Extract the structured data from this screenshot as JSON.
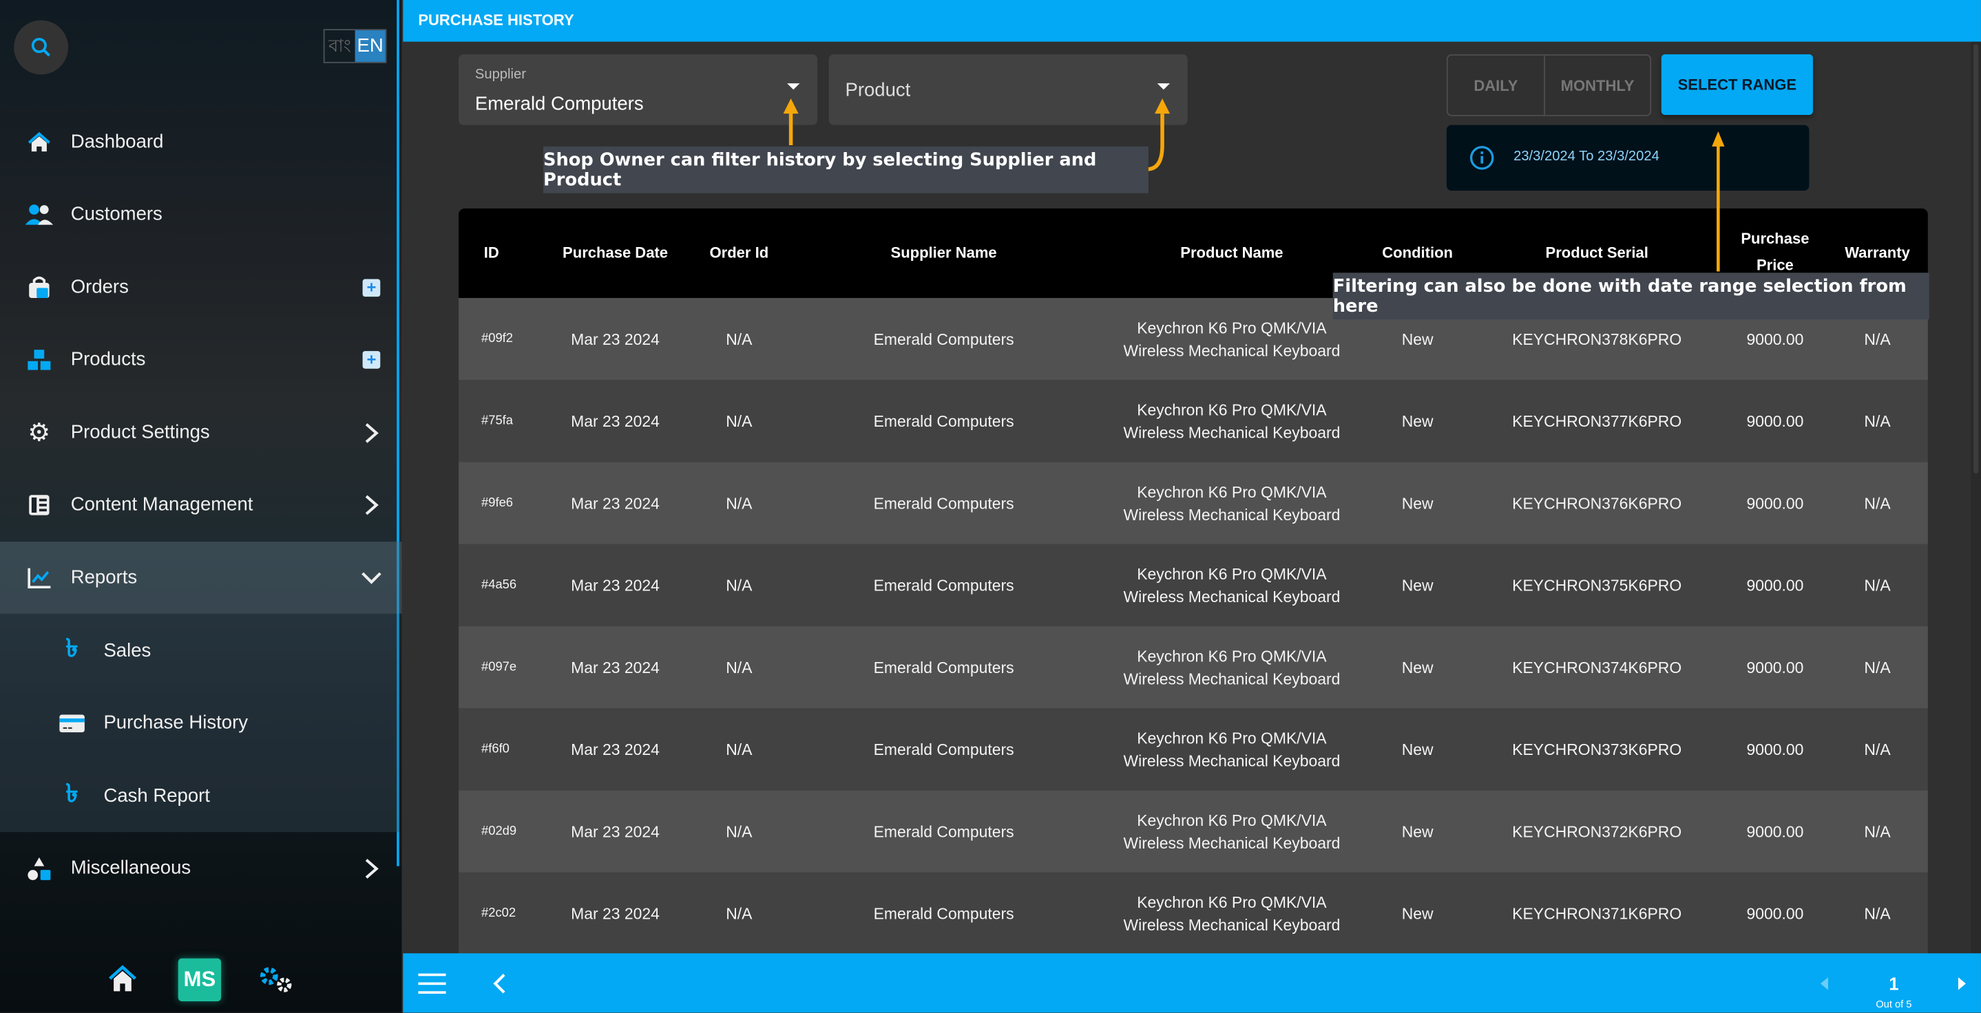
{
  "sidebar": {
    "lang": {
      "bn": "বাং",
      "en": "EN"
    },
    "items": [
      {
        "label": "Dashboard",
        "icon": "home-icon"
      },
      {
        "label": "Customers",
        "icon": "customers-icon"
      },
      {
        "label": "Orders",
        "icon": "orders-bag-icon"
      },
      {
        "label": "Products",
        "icon": "products-boxes-icon"
      },
      {
        "label": "Product Settings",
        "icon": "gear-icon"
      },
      {
        "label": "Content Management",
        "icon": "content-icon"
      },
      {
        "label": "Reports",
        "icon": "chart-line-icon"
      },
      {
        "label": "Miscellaneous",
        "icon": "shapes-icon"
      }
    ],
    "sub_items": [
      {
        "label": "Sales",
        "icon": "taka-icon"
      },
      {
        "label": "Purchase History",
        "icon": "credit-card-icon"
      },
      {
        "label": "Cash Report",
        "icon": "taka-icon"
      }
    ],
    "footer": {
      "logo": "MS"
    }
  },
  "header": {
    "title": "PURCHASE HISTORY"
  },
  "filters": {
    "supplier_label": "Supplier",
    "supplier_value": "Emerald Computers",
    "product_placeholder": "Product",
    "daily": "DAILY",
    "monthly": "MONTHLY",
    "select_range": "SELECT RANGE",
    "range_text": "23/3/2024 To 23/3/2024"
  },
  "annotations": {
    "filter_note": "Shop Owner can filter history by selecting Supplier and Product",
    "range_note": "Filtering can also be done with date range selection from here",
    "arrow_color": "#f5a70a"
  },
  "table": {
    "columns": [
      "ID",
      "Purchase Date",
      "Order Id",
      "Supplier Name",
      "Product Name",
      "Condition",
      "Product Serial",
      "Purchase Price",
      "Warranty"
    ],
    "rows": [
      [
        "#09f2",
        "Mar 23 2024",
        "N/A",
        "Emerald Computers",
        "Keychron K6 Pro QMK/VIA\nWireless Mechanical Keyboard",
        "New",
        "KEYCHRON378K6PRO",
        "9000.00",
        "N/A"
      ],
      [
        "#75fa",
        "Mar 23 2024",
        "N/A",
        "Emerald Computers",
        "Keychron K6 Pro QMK/VIA\nWireless Mechanical Keyboard",
        "New",
        "KEYCHRON377K6PRO",
        "9000.00",
        "N/A"
      ],
      [
        "#9fe6",
        "Mar 23 2024",
        "N/A",
        "Emerald Computers",
        "Keychron K6 Pro QMK/VIA\nWireless Mechanical Keyboard",
        "New",
        "KEYCHRON376K6PRO",
        "9000.00",
        "N/A"
      ],
      [
        "#4a56",
        "Mar 23 2024",
        "N/A",
        "Emerald Computers",
        "Keychron K6 Pro QMK/VIA\nWireless Mechanical Keyboard",
        "New",
        "KEYCHRON375K6PRO",
        "9000.00",
        "N/A"
      ],
      [
        "#097e",
        "Mar 23 2024",
        "N/A",
        "Emerald Computers",
        "Keychron K6 Pro QMK/VIA\nWireless Mechanical Keyboard",
        "New",
        "KEYCHRON374K6PRO",
        "9000.00",
        "N/A"
      ],
      [
        "#f6f0",
        "Mar 23 2024",
        "N/A",
        "Emerald Computers",
        "Keychron K6 Pro QMK/VIA\nWireless Mechanical Keyboard",
        "New",
        "KEYCHRON373K6PRO",
        "9000.00",
        "N/A"
      ],
      [
        "#02d9",
        "Mar 23 2024",
        "N/A",
        "Emerald Computers",
        "Keychron K6 Pro QMK/VIA\nWireless Mechanical Keyboard",
        "New",
        "KEYCHRON372K6PRO",
        "9000.00",
        "N/A"
      ],
      [
        "#2c02",
        "Mar 23 2024",
        "N/A",
        "Emerald Computers",
        "Keychron K6 Pro QMK/VIA\nWireless Mechanical Keyboard",
        "New",
        "KEYCHRON371K6PRO",
        "9000.00",
        "N/A"
      ]
    ]
  },
  "pagination": {
    "page": "1",
    "total_label": "Out of 5"
  },
  "colors": {
    "accent": "#03a9f4",
    "row_a": "#515151",
    "row_b": "#424242",
    "header": "#000000"
  }
}
